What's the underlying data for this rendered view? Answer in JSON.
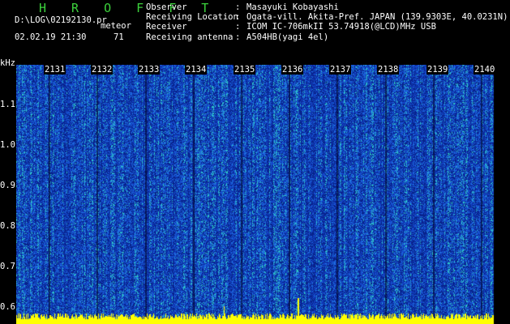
{
  "header": {
    "app_title": "H R O F F T",
    "log_path": "D:\\LOG\\02192130.pr",
    "mode": "meteor",
    "date_time": "02.02.19 21:30",
    "count": "71",
    "info": [
      {
        "label": "Observer",
        "value": "Masayuki Kobayashi"
      },
      {
        "label": "Receiving Location",
        "value": "Ogata-vill. Akita-Pref. JAPAN (139.9303E, 40.0231N)"
      },
      {
        "label": "Receiver",
        "value": "ICOM IC-706mkII 53.74918(@LCD)MHz USB"
      },
      {
        "label": "Receiving antenna",
        "value": "A504HB(yagi 4el)"
      }
    ],
    "separator": ":"
  },
  "spectrogram": {
    "unit_label": "kHz",
    "minute_labels": [
      "2131",
      "2132",
      "2133",
      "2134",
      "2135",
      "2136",
      "2137",
      "2138",
      "2139",
      "2140"
    ],
    "freq_labels": [
      "1.1",
      "1.0",
      "0.9",
      "0.8",
      "0.7",
      "0.6"
    ],
    "colors": {
      "background": "#0a2a9a",
      "noise_mid": "#1e5adc",
      "noise_high": "#2ec8c8",
      "baseline": "#ffff00"
    }
  }
}
